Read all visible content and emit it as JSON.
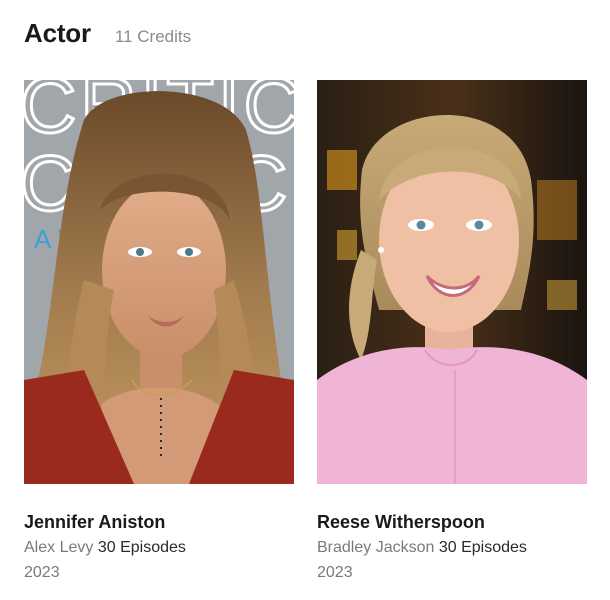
{
  "header": {
    "title": "Actor",
    "credits": "11 Credits"
  },
  "cards": [
    {
      "name": "Jennifer Aniston",
      "character": "Alex Levy",
      "episodes": "30 Episodes",
      "year": "2023",
      "photo_backdrop_text": "CRITICS CHOICE AWARDS"
    },
    {
      "name": "Reese Witherspoon",
      "character": "Bradley Jackson",
      "episodes": "30 Episodes",
      "year": "2023"
    }
  ],
  "colors": {
    "title": "#1a1a1a",
    "muted": "#7a7a7a",
    "backdrop_gray": "#9ea3a8",
    "backdrop_dark": "#1f1a14",
    "accent_blue": "#3aa0d8",
    "red_dress": "#9b2a1e",
    "pink_top": "#f0b5d6"
  }
}
